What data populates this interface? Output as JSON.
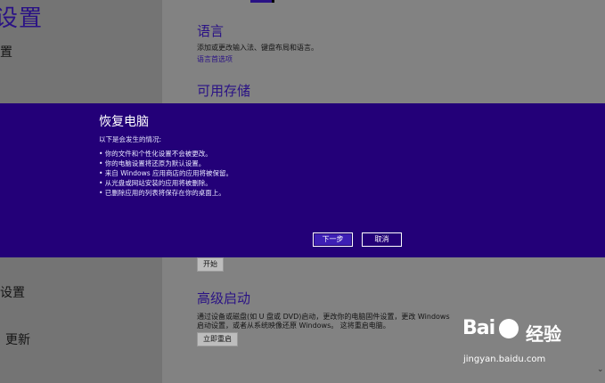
{
  "left": {
    "title": "设置",
    "item1": "置",
    "item2": "设置",
    "item3": "更新"
  },
  "right": {
    "language": {
      "title": "语言",
      "desc": "添加或更改输入法、键盘布局和语言。",
      "link": "语言首选项"
    },
    "storage": {
      "title": "可用存储"
    },
    "reset": {
      "start_button": "开始"
    },
    "advanced": {
      "title": "高级启动",
      "desc_line1": "通过设备或磁盘(如 U 盘或 DVD)启动，更改你的电脑固件设置，更改 Windows",
      "desc_line2": "启动设置，或者从系统映像还原 Windows。 这将重启电脑。",
      "button": "立即重启"
    }
  },
  "dialog": {
    "title": "恢复电脑",
    "subtitle": "以下是会发生的情况:",
    "items": [
      "• 你的文件和个性化设置不会被更改。",
      "• 你的电脑设置将还原为默认设置。",
      "• 来自 Windows 应用商店的应用将被保留。",
      "• 从光盘或网站安装的应用将被删除。",
      "• 已删除应用的列表将保存在你的桌面上。"
    ],
    "next_button": "下一步",
    "cancel_button": "取消"
  },
  "watermark": {
    "brand": "Bai",
    "brand2": "经验",
    "url": "jingyan.baidu.com"
  },
  "colors": {
    "dialog_bg": "#230078",
    "accent": "#2a1285"
  }
}
